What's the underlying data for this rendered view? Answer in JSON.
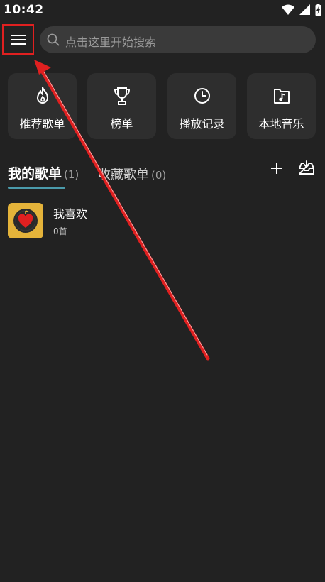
{
  "status": {
    "time": "10:42",
    "icons": [
      "wifi-icon",
      "signal-icon",
      "battery-charging-icon"
    ]
  },
  "header": {
    "menu_icon": "hamburger-menu-icon",
    "search_placeholder": "点击这里开始搜索",
    "search_icon": "search-icon"
  },
  "quick": [
    {
      "label": "推荐歌单",
      "icon": "flame-icon"
    },
    {
      "label": "榜单",
      "icon": "trophy-icon"
    },
    {
      "label": "播放记录",
      "icon": "clock-icon"
    },
    {
      "label": "本地音乐",
      "icon": "music-folder-icon"
    }
  ],
  "tabs": {
    "mine_label": "我的歌单",
    "mine_count": "(1)",
    "fav_label": "收藏歌单",
    "fav_count": "(0)"
  },
  "actions": {
    "add_icon": "plus-icon",
    "import_icon": "import-tray-icon"
  },
  "playlists": [
    {
      "title": "我喜欢",
      "count": "0首",
      "cover": "heart-record-cover"
    }
  ],
  "colors": {
    "background": "#222222",
    "accent": "#4b9bab",
    "annotation": "#e02020",
    "cover": "#e4b33a"
  }
}
